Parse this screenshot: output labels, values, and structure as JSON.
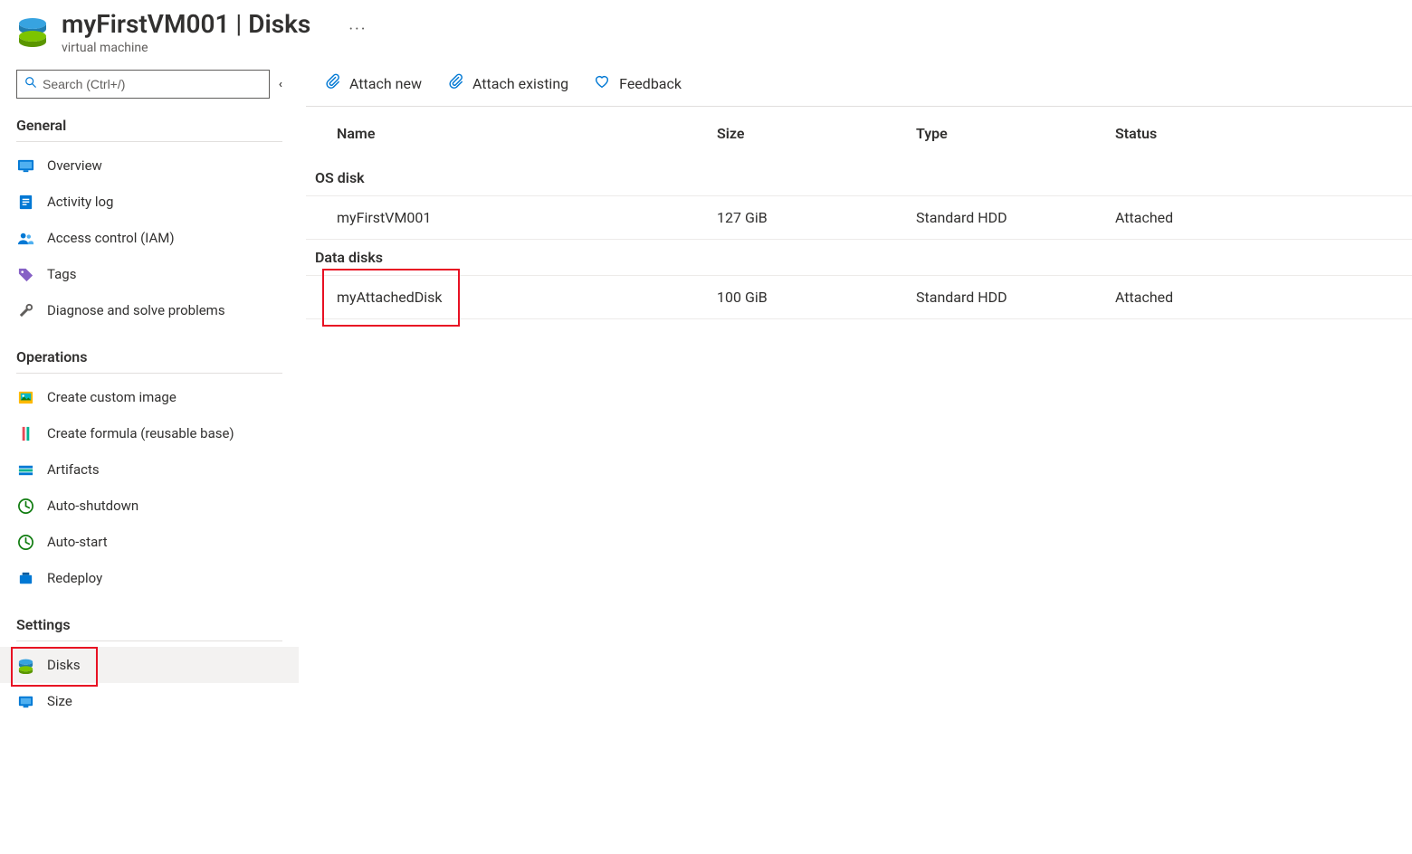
{
  "header": {
    "resource_name": "myFirstVM001",
    "separator": "|",
    "section": "Disks",
    "subtitle": "virtual machine",
    "ellipsis": "···"
  },
  "search": {
    "placeholder": "Search (Ctrl+/)"
  },
  "sidebar": {
    "sections": {
      "general": {
        "label": "General",
        "items": [
          {
            "label": "Overview"
          },
          {
            "label": "Activity log"
          },
          {
            "label": "Access control (IAM)"
          },
          {
            "label": "Tags"
          },
          {
            "label": "Diagnose and solve problems"
          }
        ]
      },
      "operations": {
        "label": "Operations",
        "items": [
          {
            "label": "Create custom image"
          },
          {
            "label": "Create formula (reusable base)"
          },
          {
            "label": "Artifacts"
          },
          {
            "label": "Auto-shutdown"
          },
          {
            "label": "Auto-start"
          },
          {
            "label": "Redeploy"
          }
        ]
      },
      "settings": {
        "label": "Settings",
        "items": [
          {
            "label": "Disks"
          },
          {
            "label": "Size"
          }
        ]
      }
    }
  },
  "toolbar": {
    "attach_new": "Attach new",
    "attach_existing": "Attach existing",
    "feedback": "Feedback"
  },
  "disks": {
    "columns": {
      "name": "Name",
      "size": "Size",
      "type": "Type",
      "status": "Status"
    },
    "groups": {
      "os": {
        "label": "OS disk",
        "rows": [
          {
            "name": "myFirstVM001",
            "size": "127 GiB",
            "type": "Standard HDD",
            "status": "Attached"
          }
        ]
      },
      "data": {
        "label": "Data disks",
        "rows": [
          {
            "name": "myAttachedDisk",
            "size": "100 GiB",
            "type": "Standard HDD",
            "status": "Attached"
          }
        ]
      }
    }
  }
}
